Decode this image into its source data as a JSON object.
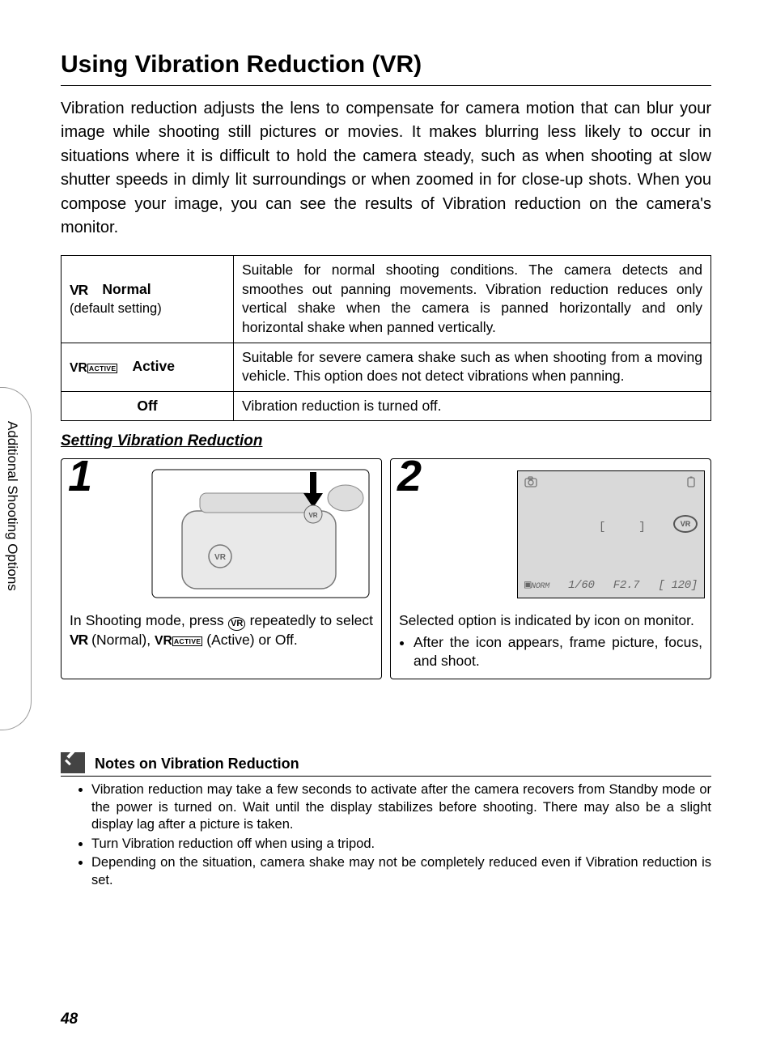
{
  "side_label": "Additional Shooting Options",
  "title": "Using Vibration Reduction (VR)",
  "intro": "Vibration reduction adjusts the lens to compensate for camera motion that can blur your image while shooting still pictures or movies. It makes blurring less likely to occur in situations where it is difficult to hold the camera steady, such as when shooting at slow shutter speeds in dimly lit surroundings or when zoomed in for close-up shots. When you compose your image, you can see the results of Vibration reduction on the camera's monitor.",
  "modes": [
    {
      "icon": "VR",
      "name": "Normal",
      "sub": "(default setting)",
      "desc": "Suitable for normal shooting conditions. The camera detects and smoothes out panning movements. Vibration reduction reduces only vertical shake when the camera is panned horizontally and only horizontal shake when panned vertically."
    },
    {
      "icon": "VR_ACTIVE",
      "name": "Active",
      "sub": "",
      "desc": "Suitable for severe camera shake such as when shooting from a moving vehicle. This option does not detect vibrations when panning."
    },
    {
      "icon": "",
      "name": "Off",
      "sub": "",
      "desc": "Vibration reduction is turned off."
    }
  ],
  "setting_heading": "Setting Vibration Reduction",
  "steps": {
    "one": {
      "num": "1",
      "text_before": "In Shooting mode, press ",
      "text_mid1": " repeatedly to select ",
      "mode1": " (Normal), ",
      "mode2": " (Active) or Off."
    },
    "two": {
      "num": "2",
      "line1": "Selected option is indicated by icon on monitor.",
      "bullet": "After the icon appears, frame picture, focus, and shoot."
    }
  },
  "monitor": {
    "vr_label": "VR",
    "quality": "NORM",
    "shutter": "1/60",
    "aperture": "F2.7",
    "remaining": "[  120]"
  },
  "notes": {
    "heading": "Notes on Vibration Reduction",
    "items": [
      "Vibration reduction may take a few seconds to activate after the camera recovers from Standby mode or the power is turned on. Wait until the display stabilizes before shooting. There may also be a slight display lag after a picture is taken.",
      "Turn Vibration reduction off when using a tripod.",
      "Depending on the situation, camera shake may not be completely reduced even if Vibration reduction is set."
    ]
  },
  "page_number": "48"
}
